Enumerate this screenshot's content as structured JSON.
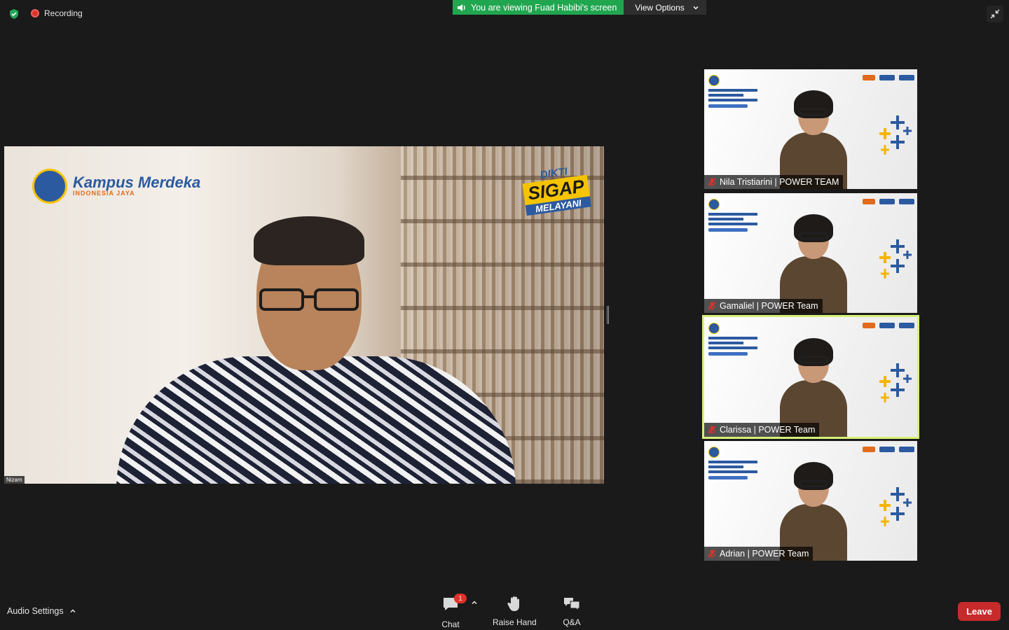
{
  "top_bar": {
    "recording_label": "Recording",
    "viewing_banner": "You are viewing Fuad Habibi's screen",
    "view_options_label": "View Options"
  },
  "main_video": {
    "speaker_tag": "Nizam",
    "logo_left_title": "Kampus Merdeka",
    "logo_left_subtitle": "INDONESIA JAYA",
    "logo_right_line1": "DIKTI",
    "logo_right_line2": "SIGAP",
    "logo_right_line3": "MELAYANI"
  },
  "participants": [
    {
      "name": "Nila Tristiarini | POWER TEAM",
      "active": false
    },
    {
      "name": "Gamaliel | POWER Team",
      "active": false
    },
    {
      "name": "Clarissa | POWER Team",
      "active": true
    },
    {
      "name": "Adrian | POWER Team",
      "active": false
    }
  ],
  "toolbar": {
    "audio_settings_label": "Audio Settings",
    "chat_label": "Chat",
    "chat_badge": "1",
    "raise_hand_label": "Raise Hand",
    "qa_label": "Q&A",
    "leave_label": "Leave"
  },
  "colors": {
    "background": "#1a1a1a",
    "banner_green": "#21a650",
    "leave_red": "#c72a2a",
    "active_speaker_outline": "#d6f07a"
  },
  "icons": [
    "shield-check-icon",
    "record-dot-icon",
    "speaker-icon",
    "chevron-down-icon",
    "exit-fullscreen-icon",
    "mic-muted-icon",
    "chat-icon",
    "chevron-up-icon",
    "raise-hand-icon",
    "qa-icon"
  ]
}
